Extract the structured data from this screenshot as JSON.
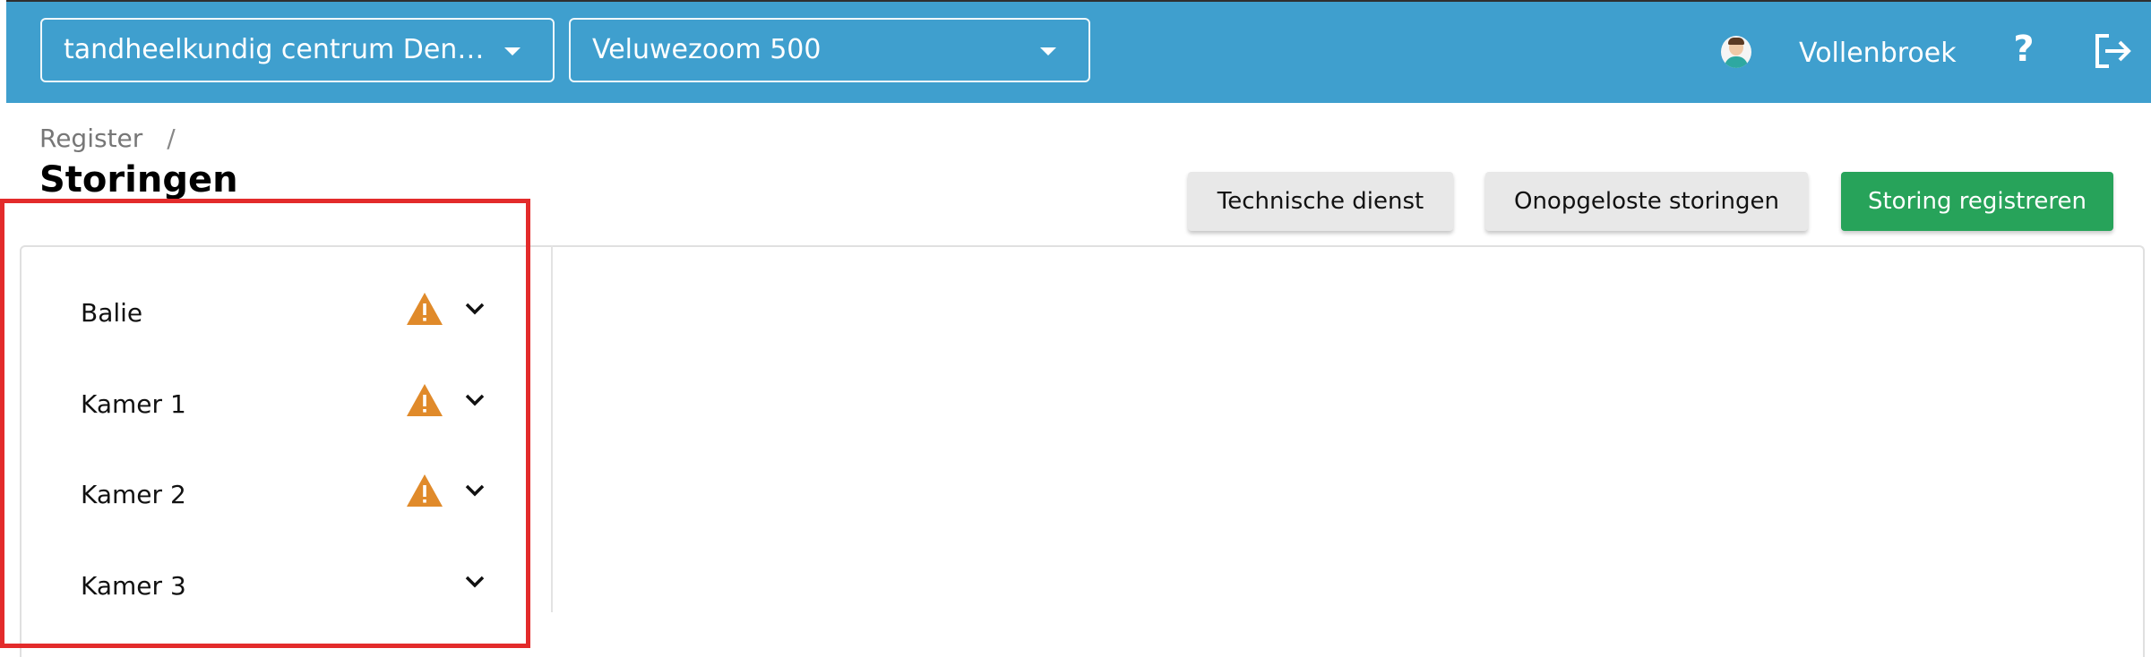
{
  "header": {
    "practice_select": "tandheelkundig centrum Dentaal",
    "location_select": "Veluwezoom 500",
    "user_name": "Vollenbroek",
    "help_symbol": "?",
    "icons": [
      "avatar",
      "help-icon",
      "logout-icon",
      "caret-down-icon"
    ],
    "background_color": "#3f9fce"
  },
  "breadcrumb": {
    "items": [
      "Register"
    ],
    "separator": "/"
  },
  "page": {
    "title": "Storingen"
  },
  "actions": {
    "technical_service": "Technische dienst",
    "unresolved_faults": "Onopgeloste storingen",
    "register_fault": "Storing registreren",
    "primary_color": "#27a35a"
  },
  "rooms": [
    {
      "label": "Balie",
      "warning": true
    },
    {
      "label": "Kamer 1",
      "warning": true
    },
    {
      "label": "Kamer 2",
      "warning": true
    },
    {
      "label": "Kamer 3",
      "warning": false
    }
  ],
  "colors": {
    "warning": "#e08a2a",
    "highlight": "#e32b2b"
  }
}
